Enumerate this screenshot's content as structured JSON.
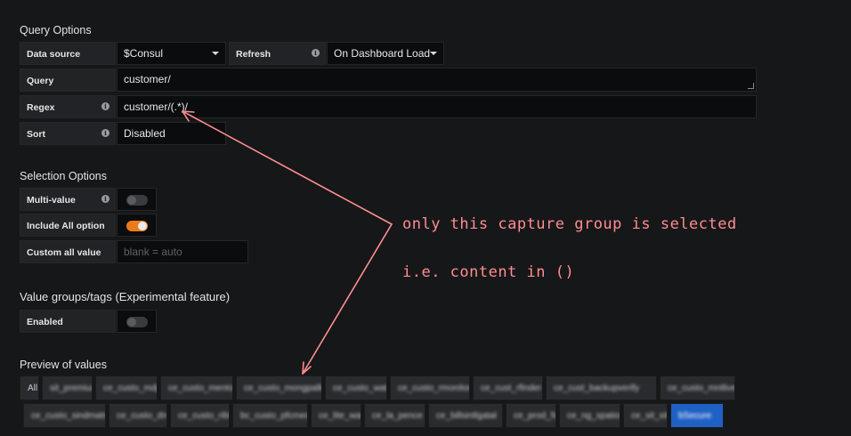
{
  "query_options": {
    "title": "Query Options",
    "datasource_label": "Data source",
    "datasource_value": "$Consul",
    "refresh_label": "Refresh",
    "refresh_value": "On Dashboard Load",
    "query_label": "Query",
    "query_value": "customer/",
    "regex_label": "Regex",
    "regex_value": "customer/(.*)/",
    "sort_label": "Sort",
    "sort_value": "Disabled"
  },
  "selection_options": {
    "title": "Selection Options",
    "multi_value_label": "Multi-value",
    "multi_value_on": false,
    "include_all_label": "Include All option",
    "include_all_on": true,
    "custom_all_label": "Custom all value",
    "custom_all_placeholder": "blank = auto"
  },
  "value_groups": {
    "title": "Value groups/tags (Experimental feature)",
    "enabled_label": "Enabled",
    "enabled_on": false
  },
  "preview": {
    "title": "Preview of values",
    "row1": [
      "All",
      "sit_premium",
      "ce_custo_mdp",
      "ce_custo_mentor",
      "ce_custo_mongpalk",
      "ce_custo_watch",
      "ce_custo_rmonitori",
      "ce_cust_rfinder",
      "ce_cust_backupverify",
      "ce_custo_mntlive"
    ],
    "row2": [
      "ce_custo_sindmatri",
      "ce_custo_dns",
      "ce_custo_ribbon",
      "bc_custo_pfcmed",
      "ce_lite_wait",
      "ce_la_pence",
      "ce_billsintlgatal",
      "ce_prod_fds",
      "ce_ng_spation",
      "ce_sit_site",
      "bSecure"
    ]
  },
  "annotation": {
    "line1": "only this capture group is selected",
    "line2": "i.e. content in ()"
  },
  "icons": {
    "info": "info-icon",
    "caret": "chevron-down-icon"
  },
  "colors": {
    "accent_orange": "#eb7b18",
    "selected_blue": "#1f60c4",
    "annotation": "#ff8d91"
  }
}
